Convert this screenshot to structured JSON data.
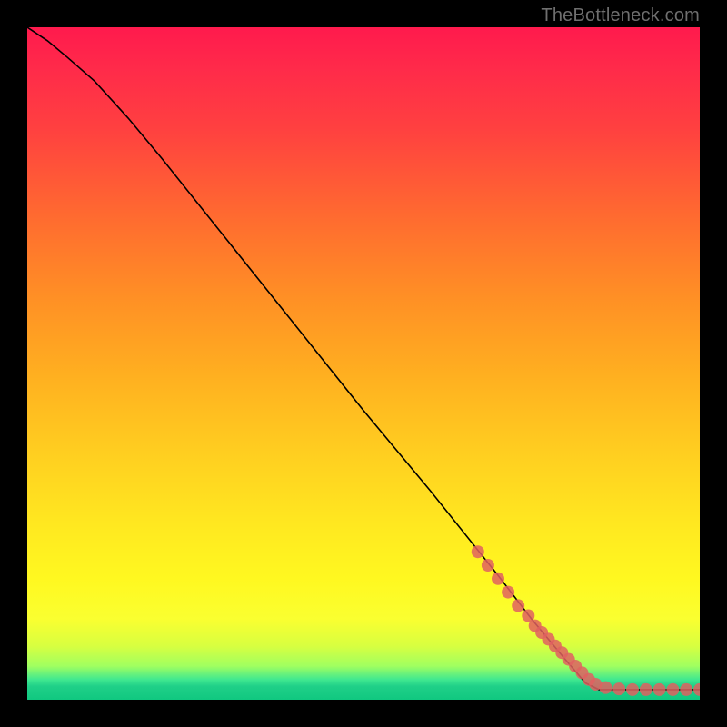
{
  "watermark": "TheBottleneck.com",
  "chart_data": {
    "type": "line",
    "title": "",
    "xlabel": "",
    "ylabel": "",
    "xlim": [
      0,
      100
    ],
    "ylim": [
      0,
      100
    ],
    "grid": false,
    "series": [
      {
        "name": "curve",
        "style": "line",
        "color": "#000000",
        "x": [
          0,
          3,
          6,
          10,
          15,
          20,
          30,
          40,
          50,
          60,
          70,
          75,
          80,
          83,
          85,
          88,
          90,
          95,
          100
        ],
        "y": [
          100,
          98,
          95.5,
          92,
          86.5,
          80.5,
          68,
          55.5,
          43,
          31,
          18.5,
          12,
          6,
          2.5,
          1.5,
          1.5,
          1.5,
          1.5,
          1.5
        ]
      },
      {
        "name": "highlighted-segment",
        "style": "points",
        "color": "#e06060",
        "x": [
          67,
          68.5,
          70,
          71.5,
          73,
          74.5,
          75.5,
          76.5,
          77.5,
          78.5,
          79.5,
          80.5,
          81.5,
          82.5,
          83.5,
          84.5,
          86,
          88,
          90,
          92,
          94,
          96,
          98,
          100
        ],
        "y": [
          22,
          20,
          18,
          16,
          14,
          12.5,
          11,
          10,
          9,
          8,
          7,
          6,
          5,
          4,
          3,
          2.3,
          1.8,
          1.6,
          1.5,
          1.5,
          1.5,
          1.5,
          1.5,
          1.5
        ]
      }
    ]
  }
}
